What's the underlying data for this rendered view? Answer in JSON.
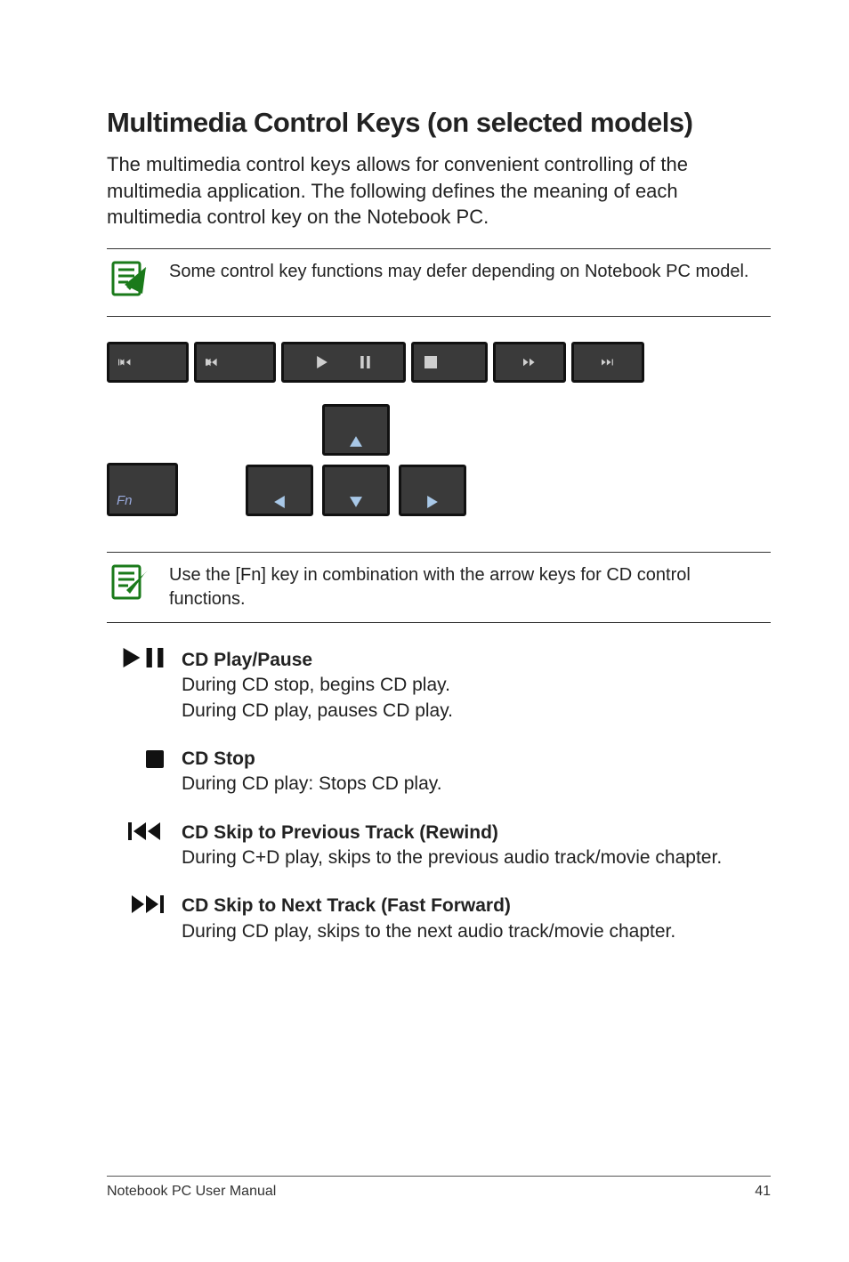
{
  "heading": "Multimedia Control Keys (on selected models)",
  "lead": "The multimedia control keys allows for convenient controlling of the multimedia application. The following defines the meaning of each multimedia control key on the Notebook PC.",
  "note1": "Some control key functions may defer depending on Notebook PC model.",
  "fn_label": "Fn",
  "note2": "Use the [Fn] key in combination with the arrow keys for CD control functions.",
  "defs": {
    "play": {
      "title": "CD Play/Pause",
      "line1": "During CD stop, begins CD play.",
      "line2": "During CD play, pauses CD play."
    },
    "stop": {
      "title": "CD Stop",
      "line1": "During CD play: Stops CD play."
    },
    "prev": {
      "title": "CD Skip to Previous Track (Rewind)",
      "line1": "During C+D play, skips to the previous audio track/movie chapter."
    },
    "next": {
      "title": "CD Skip to Next Track (Fast Forward)",
      "line1": "During CD play, skips to the next audio track/movie chapter."
    }
  },
  "footer": {
    "left": "Notebook PC User Manual",
    "right": "41"
  }
}
